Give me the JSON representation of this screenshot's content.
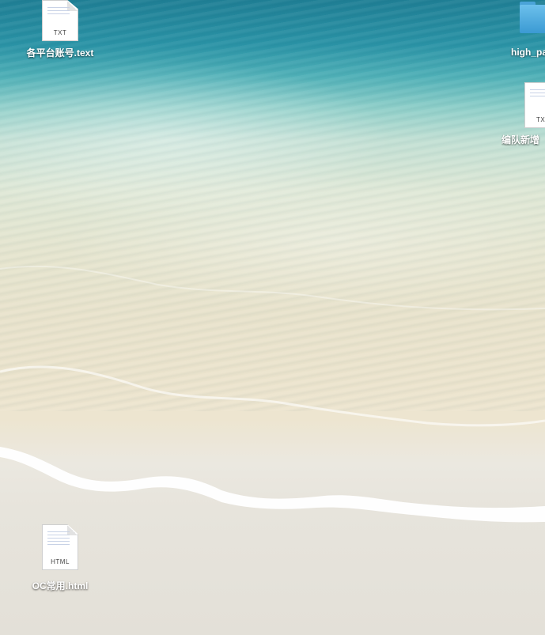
{
  "desktop": {
    "icons": [
      {
        "type_label": "TXT",
        "name": "各平台账号.text"
      },
      {
        "type_label": "",
        "name": "high_pa"
      },
      {
        "type_label": "TX",
        "name": "编队新增"
      },
      {
        "type_label": "HTML",
        "name": "OC常用.html"
      }
    ]
  }
}
